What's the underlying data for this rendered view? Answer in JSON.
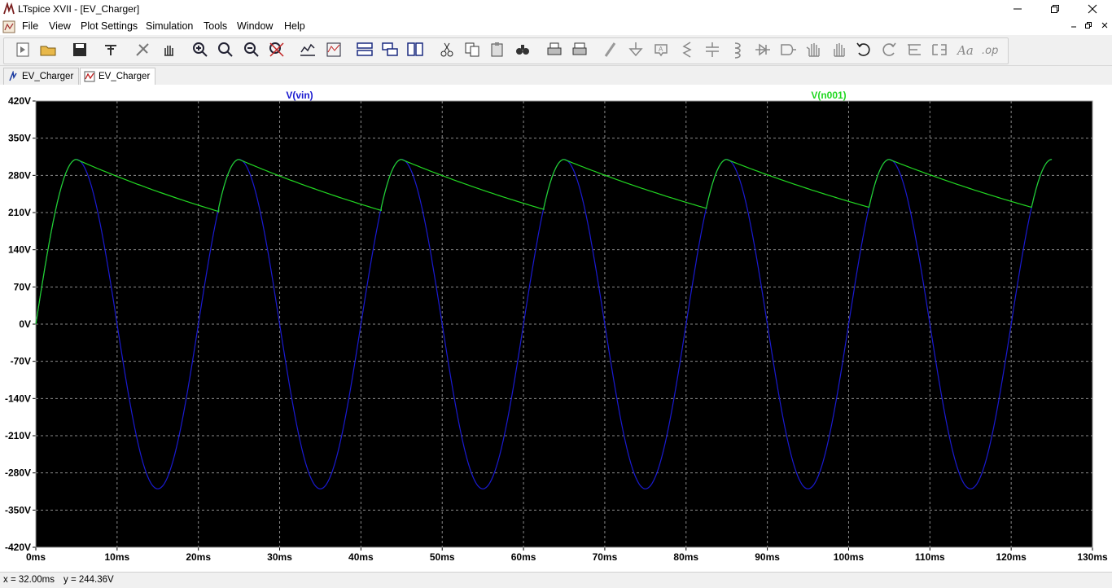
{
  "window": {
    "title": "LTspice XVII - [EV_Charger]",
    "minimize_icon": "minimize-icon",
    "restore_icon": "restore-icon",
    "close_icon": "close-icon"
  },
  "menu": [
    {
      "label": "File"
    },
    {
      "label": "View"
    },
    {
      "label": "Plot Settings"
    },
    {
      "label": "Simulation"
    },
    {
      "label": "Tools"
    },
    {
      "label": "Window"
    },
    {
      "label": "Help"
    }
  ],
  "toolbar": {
    "icons": [
      "run-icon",
      "open-icon",
      "save-icon",
      "control-panel-icon",
      "halt-icon",
      "pan-hand-icon",
      "zoom-in-icon",
      "zoom-area-icon",
      "zoom-out-icon",
      "zoom-cancel-icon",
      "autorange-icon",
      "pick-traces-icon",
      "tile-horizontal-icon",
      "cascade-icon",
      "tile-vertical-icon",
      "cut-icon",
      "copy-icon",
      "paste-icon",
      "find-icon",
      "print-icon",
      "print-setup-icon",
      "draw-wire-icon",
      "ground-icon",
      "label-icon",
      "resistor-icon",
      "capacitor-icon",
      "inductor-icon",
      "diode-icon",
      "component-icon",
      "move-icon",
      "drag-icon",
      "undo-icon",
      "redo-icon",
      "rotate-icon",
      "mirror-icon",
      "text-icon",
      "spice-directive-icon"
    ]
  },
  "tabs": [
    {
      "label": "EV_Charger",
      "type": "schematic"
    },
    {
      "label": "EV_Charger",
      "type": "waveform"
    }
  ],
  "chart_data": {
    "type": "line",
    "title": "",
    "xlabel": "",
    "ylabel": "",
    "xlim": [
      0,
      130
    ],
    "ylim": [
      -420,
      420
    ],
    "x_ticks": [
      "0ms",
      "10ms",
      "20ms",
      "30ms",
      "40ms",
      "50ms",
      "60ms",
      "70ms",
      "80ms",
      "90ms",
      "100ms",
      "110ms",
      "120ms",
      "130ms"
    ],
    "y_ticks": [
      "420V",
      "350V",
      "280V",
      "210V",
      "140V",
      "70V",
      "0V",
      "-70V",
      "-140V",
      "-210V",
      "-280V",
      "-350V",
      "-420V"
    ],
    "grid": true,
    "background": "#000000",
    "series": [
      {
        "name": "V(vin)",
        "color": "#1a1ad0",
        "kind": "sine",
        "amplitude": 310,
        "frequency_hz": 50,
        "x": [
          0,
          5,
          10,
          15,
          20,
          25,
          30,
          35,
          40,
          45,
          50,
          55,
          60,
          65,
          70,
          75,
          80,
          85,
          90,
          95,
          100,
          105,
          110,
          115,
          120,
          125
        ],
        "values": [
          0,
          310,
          0,
          -310,
          0,
          310,
          0,
          -310,
          0,
          310,
          0,
          -310,
          0,
          310,
          0,
          -310,
          0,
          310,
          0,
          -310,
          0,
          310,
          0,
          -310,
          0,
          310
        ]
      },
      {
        "name": "V(n001)",
        "color": "#22d822",
        "kind": "rectified-ripple",
        "x": [
          0,
          5,
          22.5,
          25,
          42.5,
          45,
          62.5,
          65,
          82.5,
          85,
          102.5,
          105,
          122.5,
          125
        ],
        "values": [
          0,
          310,
          212,
          310,
          214,
          310,
          216,
          310,
          218,
          310,
          220,
          310,
          220,
          310
        ]
      }
    ]
  },
  "status": {
    "x": "x = 32.00ms",
    "y": "y = 244.36V"
  }
}
